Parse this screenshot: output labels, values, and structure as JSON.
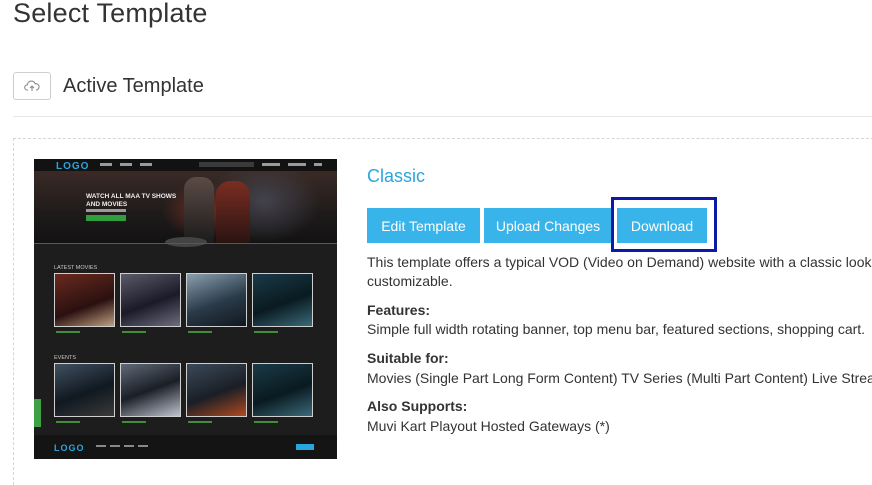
{
  "page": {
    "title": "Select Template"
  },
  "section": {
    "title": "Active Template",
    "upload_icon": "cloud-upload-icon"
  },
  "template": {
    "name": "Classic",
    "buttons": {
      "edit": "Edit Template",
      "upload": "Upload Changes",
      "download": "Download"
    },
    "description_line1": "This template offers a typical VOD (Video on Demand) website with a classic look",
    "description_line2": "customizable.",
    "features_label": "Features:",
    "features_value": "Simple full width rotating banner, top menu bar, featured sections, shopping cart.",
    "suitable_label": "Suitable for:",
    "suitable_value": "Movies (Single Part Long Form Content) TV Series (Multi Part Content) Live Stream",
    "supports_label": "Also Supports:",
    "supports_value": "Muvi Kart Playout Hosted Gateways (*)"
  },
  "preview": {
    "logo": "LOGO",
    "banner_text": "WATCH ALL MAA TV SHOWS AND MOVIES",
    "row1_label": "LATEST MOVIES",
    "row2_label": "EVENTS",
    "footer_logo": "LOGO"
  },
  "colors": {
    "accent": "#39b4ea",
    "title_link": "#2aa6de",
    "focus_ring": "#0c1aa8"
  }
}
